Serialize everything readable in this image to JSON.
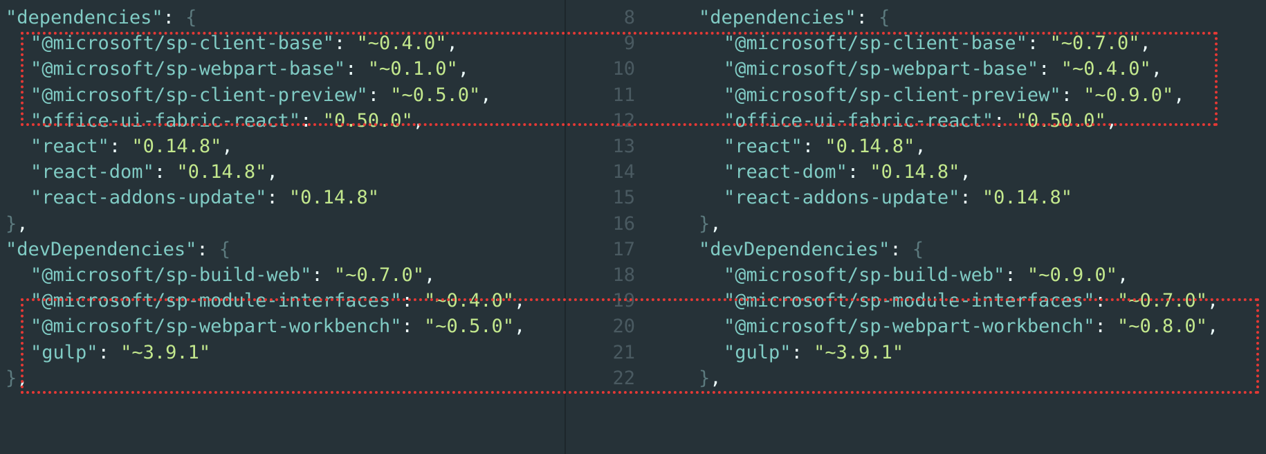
{
  "left": {
    "lines": [
      {
        "type": "open",
        "indent": 0,
        "key": "dependencies",
        "brace": "{"
      },
      {
        "type": "kv",
        "indent": 1,
        "key": "@microsoft/sp-client-base",
        "value": "~0.4.0",
        "comma": ","
      },
      {
        "type": "kv",
        "indent": 1,
        "key": "@microsoft/sp-webpart-base",
        "value": "~0.1.0",
        "comma": ","
      },
      {
        "type": "kv",
        "indent": 1,
        "key": "@microsoft/sp-client-preview",
        "value": "~0.5.0",
        "comma": ","
      },
      {
        "type": "kv",
        "indent": 1,
        "key": "office-ui-fabric-react",
        "value": "0.50.0",
        "comma": ","
      },
      {
        "type": "kv",
        "indent": 1,
        "key": "react",
        "value": "0.14.8",
        "comma": ","
      },
      {
        "type": "kv",
        "indent": 1,
        "key": "react-dom",
        "value": "0.14.8",
        "comma": ","
      },
      {
        "type": "kv",
        "indent": 1,
        "key": "react-addons-update",
        "value": "0.14.8",
        "comma": ""
      },
      {
        "type": "close",
        "indent": 0,
        "brace": "}",
        "comma": ","
      },
      {
        "type": "open",
        "indent": 0,
        "key": "devDependencies",
        "brace": "{"
      },
      {
        "type": "kv",
        "indent": 1,
        "key": "@microsoft/sp-build-web",
        "value": "~0.7.0",
        "comma": ","
      },
      {
        "type": "kv",
        "indent": 1,
        "key": "@microsoft/sp-module-interfaces",
        "value": "~0.4.0",
        "comma": ","
      },
      {
        "type": "kv",
        "indent": 1,
        "key": "@microsoft/sp-webpart-workbench",
        "value": "~0.5.0",
        "comma": ","
      },
      {
        "type": "kv",
        "indent": 1,
        "key": "gulp",
        "value": "~3.9.1",
        "comma": ""
      },
      {
        "type": "close",
        "indent": 0,
        "brace": "}",
        "comma": ","
      }
    ]
  },
  "right": {
    "lines": [
      {
        "num": "8",
        "type": "open",
        "indent": 0,
        "key": "dependencies",
        "brace": "{"
      },
      {
        "num": "9",
        "type": "kv",
        "indent": 1,
        "key": "@microsoft/sp-client-base",
        "value": "~0.7.0",
        "comma": ","
      },
      {
        "num": "10",
        "type": "kv",
        "indent": 1,
        "key": "@microsoft/sp-webpart-base",
        "value": "~0.4.0",
        "comma": ","
      },
      {
        "num": "11",
        "type": "kv",
        "indent": 1,
        "key": "@microsoft/sp-client-preview",
        "value": "~0.9.0",
        "comma": ","
      },
      {
        "num": "12",
        "type": "kv",
        "indent": 1,
        "key": "office-ui-fabric-react",
        "value": "0.50.0",
        "comma": ","
      },
      {
        "num": "13",
        "type": "kv",
        "indent": 1,
        "key": "react",
        "value": "0.14.8",
        "comma": ","
      },
      {
        "num": "14",
        "type": "kv",
        "indent": 1,
        "key": "react-dom",
        "value": "0.14.8",
        "comma": ","
      },
      {
        "num": "15",
        "type": "kv",
        "indent": 1,
        "key": "react-addons-update",
        "value": "0.14.8",
        "comma": ""
      },
      {
        "num": "16",
        "type": "close",
        "indent": 0,
        "brace": "}",
        "comma": ","
      },
      {
        "num": "17",
        "type": "open",
        "indent": 0,
        "key": "devDependencies",
        "brace": "{"
      },
      {
        "num": "18",
        "type": "kv",
        "indent": 1,
        "key": "@microsoft/sp-build-web",
        "value": "~0.9.0",
        "comma": ","
      },
      {
        "num": "19",
        "type": "kv",
        "indent": 1,
        "key": "@microsoft/sp-module-interfaces",
        "value": "~0.7.0",
        "comma": ","
      },
      {
        "num": "20",
        "type": "kv",
        "indent": 1,
        "key": "@microsoft/sp-webpart-workbench",
        "value": "~0.8.0",
        "comma": ","
      },
      {
        "num": "21",
        "type": "kv",
        "indent": 1,
        "key": "gulp",
        "value": "~3.9.1",
        "comma": ""
      },
      {
        "num": "22",
        "type": "close",
        "indent": 0,
        "brace": "}",
        "comma": ","
      }
    ]
  },
  "colors": {
    "background": "#263238",
    "key": "#80cbc4",
    "value": "#c3e88d",
    "punctuation": "#eeffff",
    "line_number": "#4a5a61",
    "highlight_border": "#e53935"
  }
}
